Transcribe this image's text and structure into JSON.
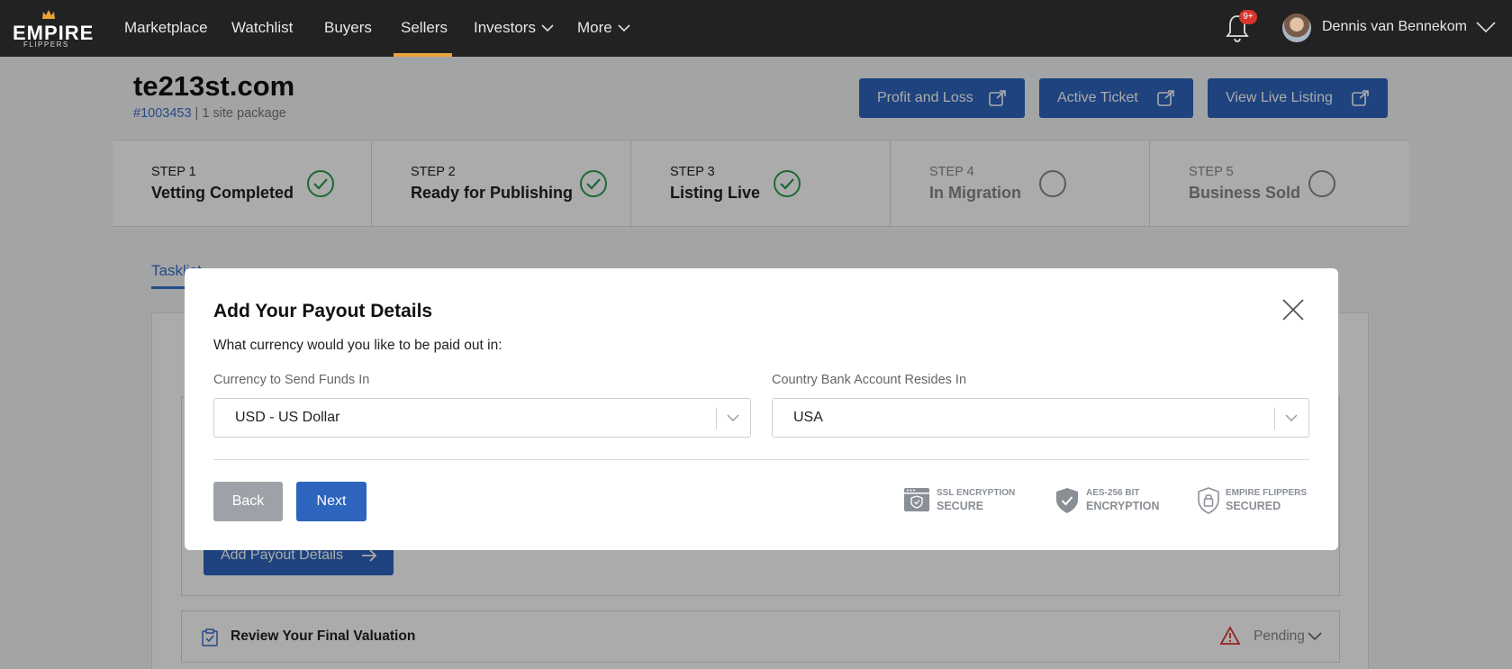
{
  "nav": {
    "logo_word": "EMPIRE",
    "logo_sub": "FLIPPERS",
    "links": [
      "Marketplace",
      "Watchlist",
      "Buyers",
      "Sellers",
      "Investors",
      "More"
    ],
    "active_link": "Sellers",
    "notification_badge": "9+",
    "user_name": "Dennis van Bennekom"
  },
  "listing": {
    "title": "te213st.com",
    "id": "#1003453",
    "separator": " | ",
    "package": "1 site package"
  },
  "actions": {
    "profit_loss": "Profit and Loss",
    "active_ticket": "Active Ticket",
    "view_live": "View Live Listing"
  },
  "steps": [
    {
      "label": "STEP 1",
      "name": "Vetting Completed",
      "status": "done"
    },
    {
      "label": "STEP 2",
      "name": "Ready for Publishing",
      "status": "done"
    },
    {
      "label": "STEP 3",
      "name": "Listing Live",
      "status": "done"
    },
    {
      "label": "STEP 4",
      "name": "In Migration",
      "status": "pending"
    },
    {
      "label": "STEP 5",
      "name": "Business Sold",
      "status": "pending"
    }
  ],
  "background": {
    "tab_label": "Tasklist",
    "add_payout_label": "Add Payout Details",
    "review_label": "Review Your Final Valuation",
    "review_status": "Pending"
  },
  "modal": {
    "title": "Add Your Payout Details",
    "question": "What currency would you like to be paid out in:",
    "currency_label": "Currency to Send Funds In",
    "currency_value": "USD - US Dollar",
    "country_label": "Country Bank Account Resides In",
    "country_value": "USA",
    "back_label": "Back",
    "next_label": "Next",
    "security": [
      {
        "line1": "SSL ENCRYPTION",
        "line2": "SECURE",
        "icon": "browser-shield-icon"
      },
      {
        "line1": "AES-256 BIT",
        "line2": "ENCRYPTION",
        "icon": "shield-check-icon"
      },
      {
        "line1": "EMPIRE FLIPPERS",
        "line2": "SECURED",
        "icon": "lock-shield-icon"
      }
    ]
  },
  "colors": {
    "nav_bg": "#222222",
    "accent": "#e8a43a",
    "primary": "#2d64bd",
    "success": "#2a9d4b",
    "badge": "#d9342b",
    "warning": "#d9342b"
  }
}
